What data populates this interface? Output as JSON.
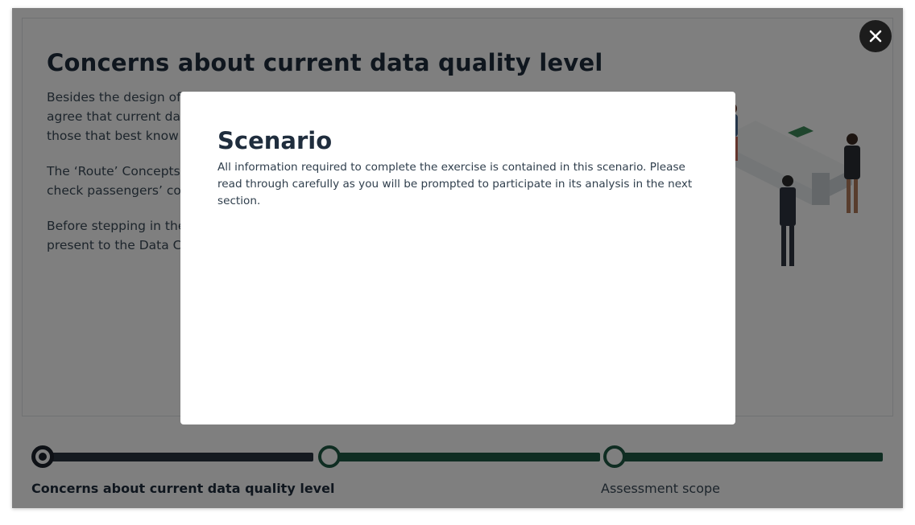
{
  "card": {
    "title": "Concerns about current data quality level",
    "paragraphs": [
      "Besides the design of quality policies for new data, the Data Office Team members agree that current data quality issues should be addressed, considering the opinions of those that best know the data.",
      "The ‘Route’ Concepts team of the Data Office Team is in charge of a platform used to check passengers’ connections and itinerary status.",
      "Before stepping in the analysis, the team will prepare a preliminary assessment to present to the Data Committee."
    ]
  },
  "progress": {
    "steps": [
      {
        "label": "Concerns about current data quality level",
        "state": "current"
      },
      {
        "label": "",
        "state": "pending"
      },
      {
        "label": "Assessment scope",
        "state": "pending"
      }
    ]
  },
  "modal": {
    "title": "Scenario",
    "body": "All information required to complete the exercise is contained in this scenario. Please read through carefully as you will be prompted to participate in its analysis in the next section.",
    "close_icon": "close-icon"
  },
  "colors": {
    "title": "#1f2d3d",
    "track_done": "#2b3440",
    "track_pending": "#1f5a44",
    "overlay": "rgba(0,0,0,0.5)"
  }
}
